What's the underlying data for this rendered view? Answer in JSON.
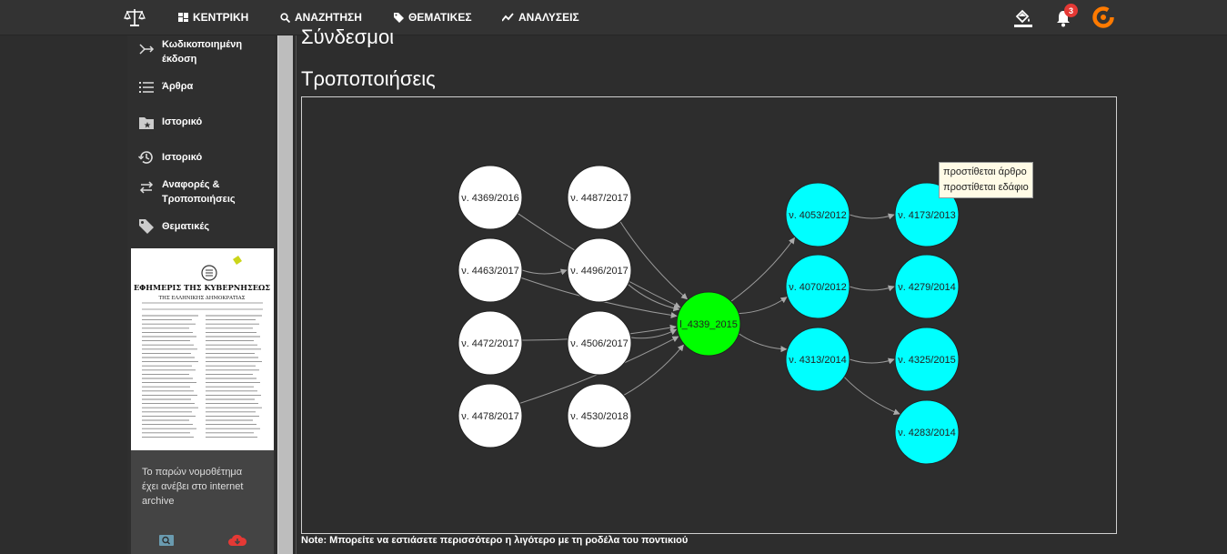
{
  "nav": {
    "items": [
      {
        "label": "ΚΕΝΤΡΙΚΗ"
      },
      {
        "label": "ΑΝΑΖΗΤΗΣΗ"
      },
      {
        "label": "ΘΕΜΑΤΙΚΕΣ"
      },
      {
        "label": "ΑΝΑΛΥΣΕΙΣ"
      }
    ],
    "notification_count": "3"
  },
  "sidebar": {
    "items": [
      {
        "line1": "Κωδικοποιημένη",
        "line2": "έκδοση",
        "icon": "codified-icon"
      },
      {
        "line1": "Άρθρα",
        "line2": "",
        "icon": "list-icon"
      },
      {
        "line1": "Ιστορικό",
        "line2": "",
        "icon": "folder-star-icon"
      },
      {
        "line1": "Ιστορικό",
        "line2": "",
        "icon": "history-icon"
      },
      {
        "line1": "Αναφορές &",
        "line2": "Τροποποιήσεις",
        "icon": "references-icon"
      },
      {
        "line1": "Θεματικές",
        "line2": "",
        "icon": "tag-icon"
      }
    ],
    "doc_preview": {
      "title": "ΕΦΗΜΕΡΙΣ ΤΗΣ ΚΥΒΕΡΝΗΣΕΩΣ",
      "subtitle": "ΤΗΣ ΕΛΛΗΝΙΚΗΣ ΔΗΜΟΚΡΑΤΙΑΣ"
    },
    "archive_text": "Το παρών νομοθέτημα έχει ανέβει στο internet archive"
  },
  "main": {
    "heading_partial": "Σύνδεσμοι",
    "section_title": "Τροποποιήσεις",
    "note_bold": "Note:",
    "note_text": " Μπορείτε να εστιάσετε περισσότερο η λιγότερο με τη ροδέλα του ποντικιού"
  },
  "graph": {
    "nodes": [
      {
        "id": "n1",
        "label": "ν. 4369/2016",
        "color": "#ffffff"
      },
      {
        "id": "n2",
        "label": "ν. 4463/2017",
        "color": "#ffffff"
      },
      {
        "id": "n3",
        "label": "ν. 4472/2017",
        "color": "#ffffff"
      },
      {
        "id": "n4",
        "label": "ν. 4478/2017",
        "color": "#ffffff"
      },
      {
        "id": "n5",
        "label": "ν. 4487/2017",
        "color": "#ffffff"
      },
      {
        "id": "n6",
        "label": "ν. 4496/2017",
        "color": "#ffffff"
      },
      {
        "id": "n7",
        "label": "ν. 4506/2017",
        "color": "#ffffff"
      },
      {
        "id": "n8",
        "label": "ν. 4530/2018",
        "color": "#ffffff"
      },
      {
        "id": "center",
        "label": "l_4339_2015",
        "color": "#00ff00"
      },
      {
        "id": "c1",
        "label": "ν. 4053/2012",
        "color": "#00ffff"
      },
      {
        "id": "c2",
        "label": "ν. 4070/2012",
        "color": "#00ffff"
      },
      {
        "id": "c3",
        "label": "ν. 4313/2014",
        "color": "#00ffff"
      },
      {
        "id": "d1",
        "label": "ν. 4173/2013",
        "color": "#00ffff"
      },
      {
        "id": "d2",
        "label": "ν. 4279/2014",
        "color": "#00ffff"
      },
      {
        "id": "d3",
        "label": "ν. 4325/2015",
        "color": "#00ffff"
      },
      {
        "id": "d4",
        "label": "ν. 4283/2014",
        "color": "#00ffff"
      }
    ],
    "edges": [
      [
        "n1",
        "center"
      ],
      [
        "n2",
        "center"
      ],
      [
        "n3",
        "center"
      ],
      [
        "n4",
        "center"
      ],
      [
        "n5",
        "center"
      ],
      [
        "n6",
        "center"
      ],
      [
        "n7",
        "center"
      ],
      [
        "n8",
        "center"
      ],
      [
        "n2",
        "n6"
      ],
      [
        "center",
        "c1"
      ],
      [
        "center",
        "c2"
      ],
      [
        "center",
        "c3"
      ],
      [
        "c1",
        "d1"
      ],
      [
        "c2",
        "d2"
      ],
      [
        "c3",
        "d3"
      ],
      [
        "c3",
        "d4"
      ]
    ],
    "tooltip": {
      "line1": "προστίθεται άρθρο",
      "line2": "προστίθεται εδάφιο"
    }
  }
}
